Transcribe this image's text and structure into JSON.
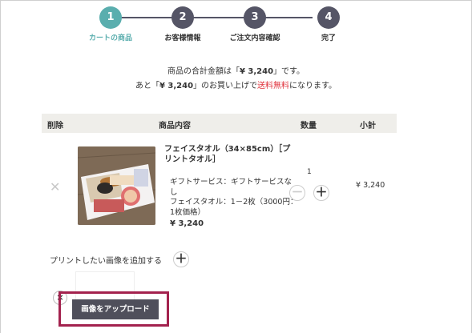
{
  "steps": [
    {
      "number": "1",
      "label": "カートの商品",
      "active": true
    },
    {
      "number": "2",
      "label": "お客様情報",
      "active": false
    },
    {
      "number": "3",
      "label": "ご注文内容確認",
      "active": false
    },
    {
      "number": "4",
      "label": "完了",
      "active": false
    }
  ],
  "colors": {
    "active_step": "#5aaeae",
    "inactive_step": "#555566",
    "accent_red": "#e0303a",
    "upload_button_bg": "#4f4f5b",
    "highlight_border": "#a3224e",
    "table_header_bg": "#efeeea"
  },
  "summary": {
    "line1_prefix": "商品の合計金額は「",
    "line1_amount": "¥ 3,240",
    "line1_suffix": "」です。",
    "line2_prefix": "あと「",
    "line2_amount": "¥ 3,240",
    "line2_mid": "」のお買い上げで",
    "line2_red": "送料無料",
    "line2_suffix": "になります。"
  },
  "table": {
    "headers": {
      "delete": "削除",
      "product": "商品内容",
      "quantity": "数量",
      "subtotal": "小計"
    }
  },
  "item": {
    "name": "フェイスタオル（34×85cm）［プリントタオル］",
    "options": [
      "ギフトサービス：ギフトサービスなし",
      "フェイスタオル：1－2枚（3000円：1枚価格）"
    ],
    "price": "¥ 3,240",
    "quantity": "1",
    "subtotal": "¥ 3,240",
    "remove_icon": "close-icon",
    "minus_label": "－",
    "plus_label": "＋"
  },
  "upload": {
    "add_label": "プリントしたい画像を追加する",
    "add_icon": "plus-icon",
    "remove_label": "×",
    "button_label": "画像をアップロード"
  }
}
